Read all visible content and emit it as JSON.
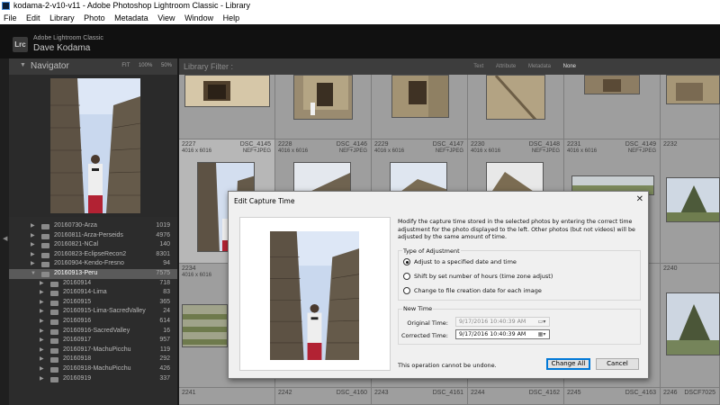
{
  "window": {
    "title": "kodama-2-v10-v11 - Adobe Photoshop Lightroom Classic - Library"
  },
  "menu": [
    "File",
    "Edit",
    "Library",
    "Photo",
    "Metadata",
    "View",
    "Window",
    "Help"
  ],
  "identity": {
    "badge": "Lrc",
    "app_name": "Adobe Lightroom Classic",
    "user_name": "Dave Kodama"
  },
  "navigator": {
    "title": "Navigator",
    "zoom_options": [
      "FIT",
      "100%",
      "50%"
    ]
  },
  "folders": [
    {
      "name": "20160730-Arza",
      "count": "1019",
      "level": 1
    },
    {
      "name": "20160811-Arza-Perseids",
      "count": "4976",
      "level": 1
    },
    {
      "name": "20160821-NCal",
      "count": "140",
      "level": 1
    },
    {
      "name": "20160823-EclipseRecon2",
      "count": "8301",
      "level": 1
    },
    {
      "name": "20160904-Kendo-Fresno",
      "count": "94",
      "level": 1
    },
    {
      "name": "20160913-Peru",
      "count": "7575",
      "level": 1,
      "selected": true,
      "expanded": true
    },
    {
      "name": "20160914",
      "count": "718",
      "level": 2
    },
    {
      "name": "20160914-Lima",
      "count": "83",
      "level": 2
    },
    {
      "name": "20160915",
      "count": "365",
      "level": 2
    },
    {
      "name": "20160915-Lima-SacredValley",
      "count": "24",
      "level": 2
    },
    {
      "name": "20160916",
      "count": "614",
      "level": 2
    },
    {
      "name": "20160916-SacredValley",
      "count": "16",
      "level": 2
    },
    {
      "name": "20160917",
      "count": "957",
      "level": 2
    },
    {
      "name": "20160917-MachuPicchu",
      "count": "119",
      "level": 2
    },
    {
      "name": "20160918",
      "count": "292",
      "level": 2
    },
    {
      "name": "20160918-MachuPicchu",
      "count": "426",
      "level": 2
    },
    {
      "name": "20160919",
      "count": "337",
      "level": 2
    }
  ],
  "filter_bar": {
    "title": "Library Filter :",
    "options": [
      "Text",
      "Attribute",
      "Metadata",
      "None"
    ],
    "active": "None"
  },
  "grid": {
    "row2": [
      {
        "idx": "2227",
        "dim": "4016 x 6016",
        "file": "DSC_4145",
        "type": "NEF+JPEG"
      },
      {
        "idx": "2228",
        "dim": "4016 x 6016",
        "file": "DSC_4146",
        "type": "NEF+JPEG"
      },
      {
        "idx": "2229",
        "dim": "4016 x 6016",
        "file": "DSC_4147",
        "type": "NEF+JPEG"
      },
      {
        "idx": "2230",
        "dim": "4016 x 6016",
        "file": "DSC_4148",
        "type": "NEF+JPEG"
      },
      {
        "idx": "2231",
        "dim": "4016 x 6016",
        "file": "DSC_4149",
        "type": "NEF+JPEG"
      },
      {
        "idx": "2232",
        "dim": "",
        "file": "",
        "type": ""
      }
    ],
    "row3": [
      {
        "idx": "2234",
        "dim": "4016 x 6016",
        "file": "",
        "type": ""
      },
      {
        "idx": "2240",
        "dim": "",
        "file": "",
        "type": ""
      }
    ],
    "row4": [
      {
        "idx": "2241",
        "dim": "",
        "file": "",
        "type": ""
      },
      {
        "idx": "2242",
        "dim": "",
        "file": "DSC_4160",
        "type": ""
      },
      {
        "idx": "2243",
        "dim": "",
        "file": "DSC_4161",
        "type": ""
      },
      {
        "idx": "2244",
        "dim": "",
        "file": "DSC_4162",
        "type": ""
      },
      {
        "idx": "2245",
        "dim": "",
        "file": "DSC_4163",
        "type": ""
      },
      {
        "idx": "2246",
        "dim": "",
        "file": "DSCF7025",
        "type": ""
      }
    ]
  },
  "dialog": {
    "title": "Edit Capture Time",
    "description": "Modify the capture time stored in the selected photos by entering the correct time adjustment for the photo displayed to the left. Other photos (but not videos) will be adjusted by the same amount of time.",
    "adjustment_group": "Type of Adjustment",
    "options": [
      {
        "label": "Adjust to a specified date and time",
        "checked": true
      },
      {
        "label": "Shift by set number of hours (time zone adjust)",
        "checked": false
      },
      {
        "label": "Change to file creation date for each image",
        "checked": false
      }
    ],
    "new_time_group": "New Time",
    "original_time_label": "Original Time:",
    "original_time_value": "9/17/2016 10:40:39 AM",
    "corrected_time_label": "Corrected Time:",
    "corrected_time_value": "9/17/2016 10:40:39 AM",
    "note": "This operation cannot be undone.",
    "change_all_label": "Change All",
    "cancel_label": "Cancel"
  },
  "colors": {
    "dialog_bg": "#f0f0f0",
    "primary_button_border": "#0078d7",
    "selected_folder": "#5a5a5a",
    "grid_bg": "#8c8c8c"
  }
}
